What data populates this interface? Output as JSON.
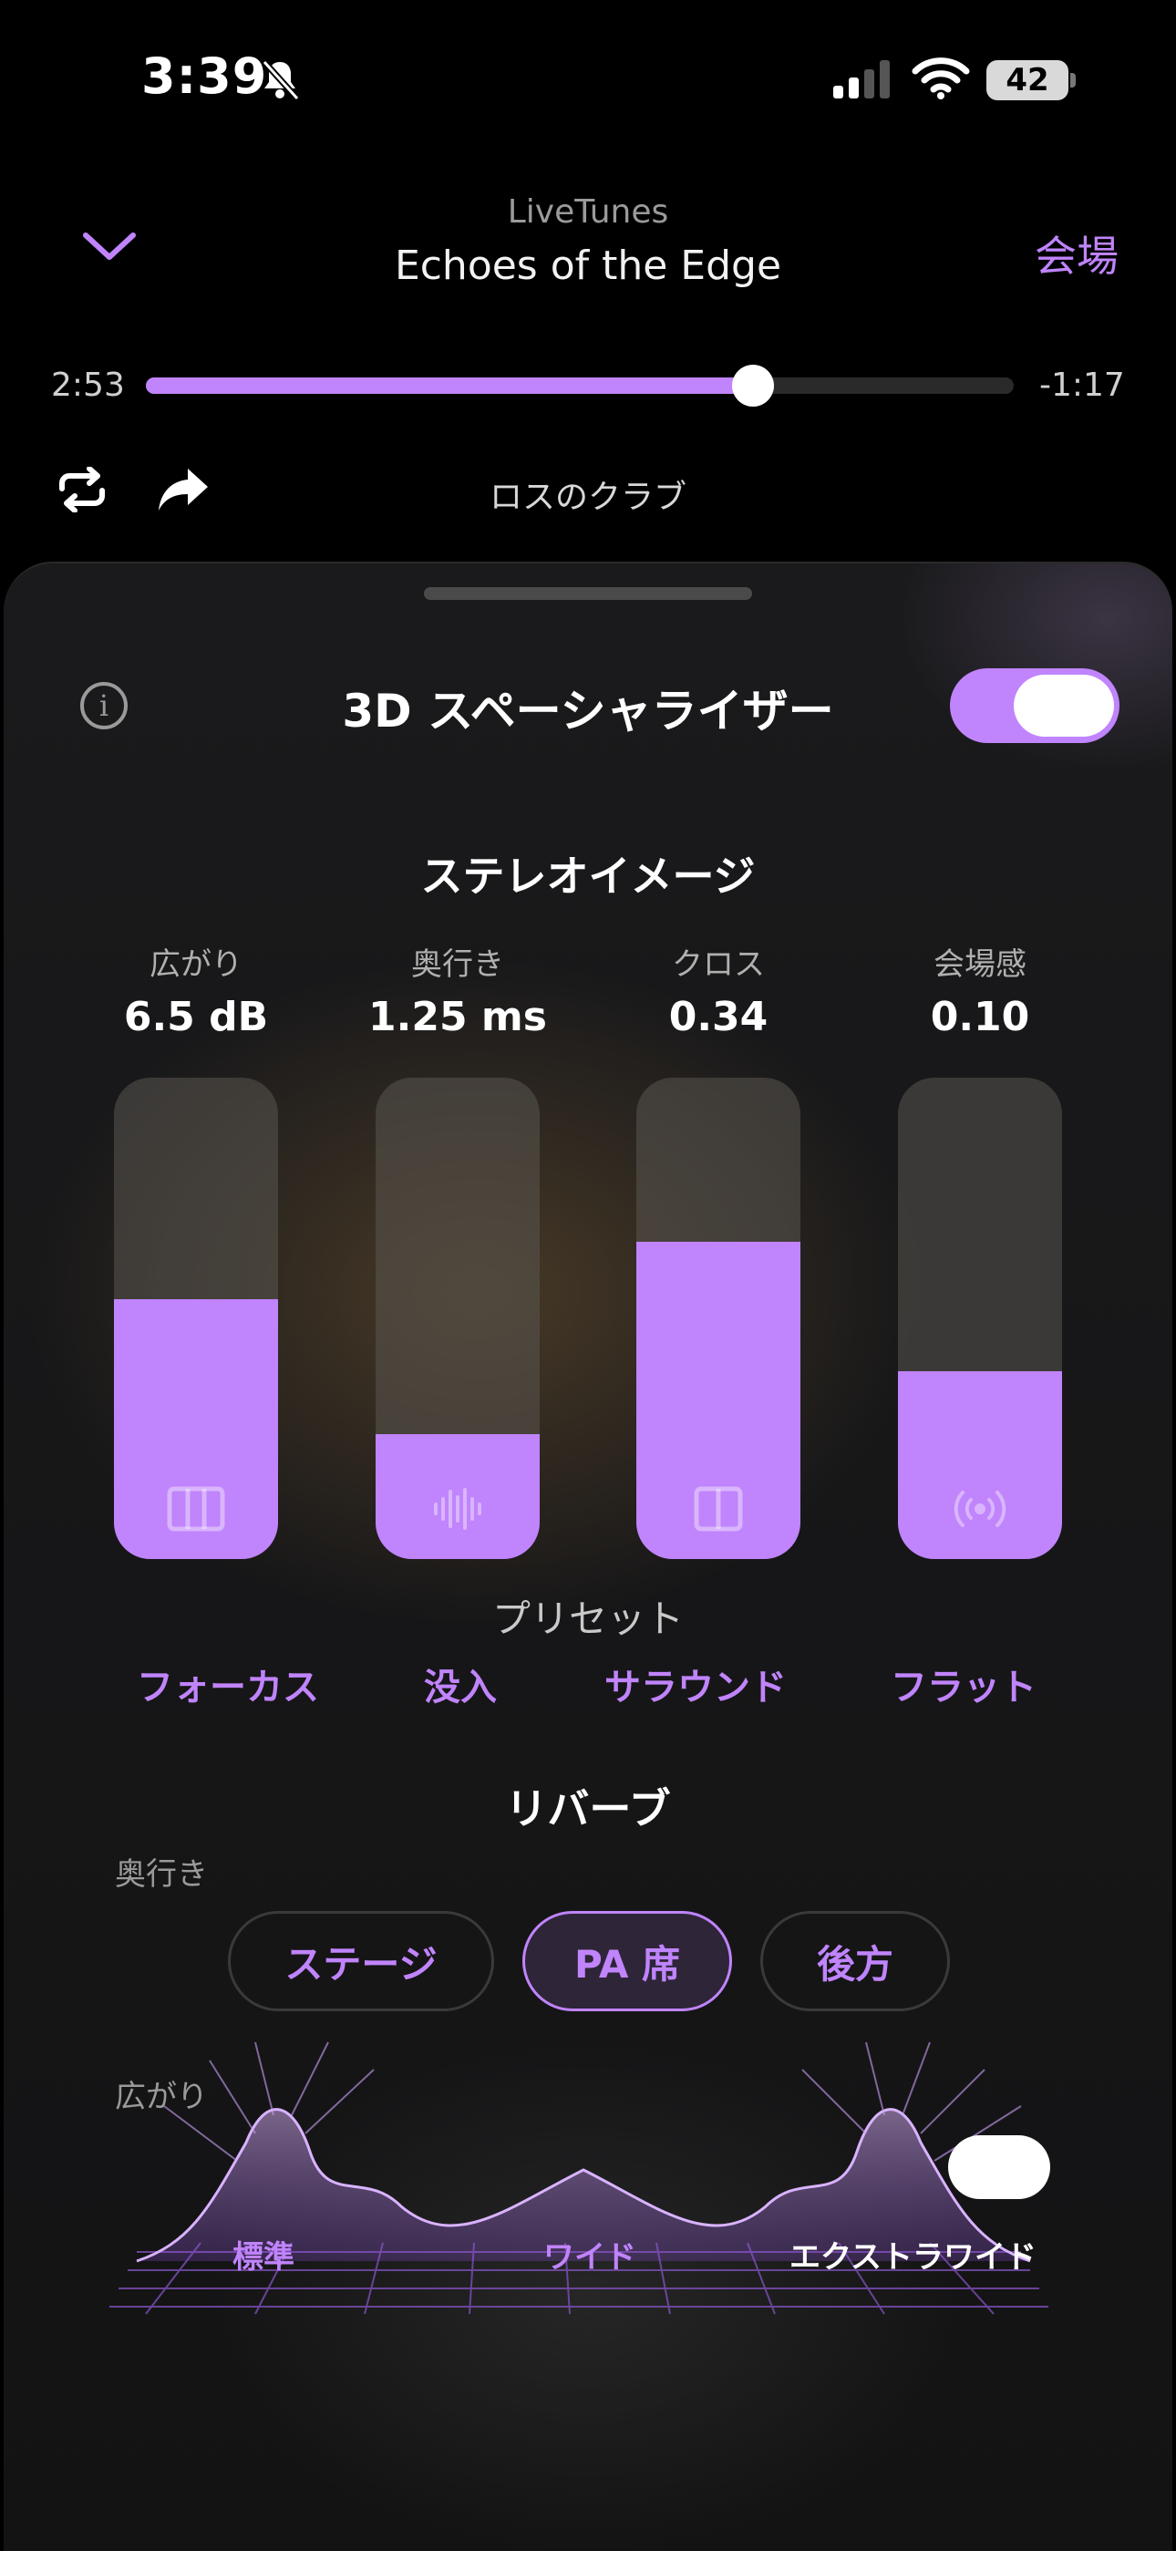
{
  "status_bar": {
    "time": "3:39",
    "battery": "42"
  },
  "header": {
    "app_name": "LiveTunes",
    "song_title": "Echoes of the Edge",
    "venue_link": "会場",
    "venue_name": "ロスのクラブ"
  },
  "playback": {
    "elapsed": "2:53",
    "remaining": "-1:17",
    "progress": 0.7
  },
  "panel": {
    "title": "3D スペーシャライザー",
    "enabled": true,
    "stereo_image": {
      "title": "ステレオイメージ",
      "params": [
        {
          "label": "広がり",
          "value": "6.5 dB",
          "level": 0.54,
          "icon": "columns-icon"
        },
        {
          "label": "奥行き",
          "value": "1.25 ms",
          "level": 0.26,
          "icon": "waveform-icon"
        },
        {
          "label": "クロス",
          "value": "0.34",
          "level": 0.66,
          "icon": "split-square-icon"
        },
        {
          "label": "会場感",
          "value": "0.10",
          "level": 0.39,
          "icon": "broadcast-icon"
        }
      ]
    },
    "presets": {
      "title": "プリセット",
      "items": [
        "フォーカス",
        "没入",
        "サラウンド",
        "フラット"
      ]
    },
    "reverb": {
      "title": "リバーブ",
      "depth_label": "奥行き",
      "depth_options": [
        "ステージ",
        "PA 席",
        "後方"
      ],
      "depth_selected": "PA 席",
      "width_label": "広がり",
      "width_options": [
        "標準",
        "ワイド",
        "エクストラワイド"
      ]
    }
  },
  "colors": {
    "accent": "#c084fc"
  }
}
